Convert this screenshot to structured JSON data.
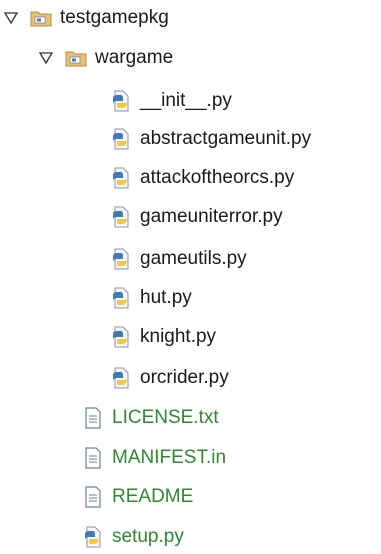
{
  "tree": {
    "root": {
      "label": "testgamepkg",
      "icon": "package-folder-icon",
      "expanded": true
    },
    "subpackage": {
      "label": "wargame",
      "icon": "package-folder-icon",
      "expanded": true
    },
    "py_files": [
      {
        "label": "__init__.py",
        "icon": "python-file-icon"
      },
      {
        "label": "abstractgameunit.py",
        "icon": "python-file-icon"
      },
      {
        "label": "attackoftheorcs.py",
        "icon": "python-file-icon"
      },
      {
        "label": "gameuniterror.py",
        "icon": "python-file-icon"
      },
      {
        "label": "gameutils.py",
        "icon": "python-file-icon"
      },
      {
        "label": "hut.py",
        "icon": "python-file-icon"
      },
      {
        "label": "knight.py",
        "icon": "python-file-icon"
      },
      {
        "label": "orcrider.py",
        "icon": "python-file-icon"
      }
    ],
    "root_files": [
      {
        "label": "LICENSE.txt",
        "icon": "text-file-icon"
      },
      {
        "label": "MANIFEST.in",
        "icon": "text-file-icon"
      },
      {
        "label": "README",
        "icon": "text-file-icon"
      },
      {
        "label": "setup.py",
        "icon": "python-file-icon"
      }
    ]
  },
  "colors": {
    "text": "#1a1a1a",
    "green_label": "#2f8a2f",
    "folder_fill": "#e8c170",
    "folder_stroke": "#b8893a",
    "python_blue": "#3f79b6",
    "python_yellow": "#f2c945",
    "doc_stroke": "#6f7f96"
  }
}
